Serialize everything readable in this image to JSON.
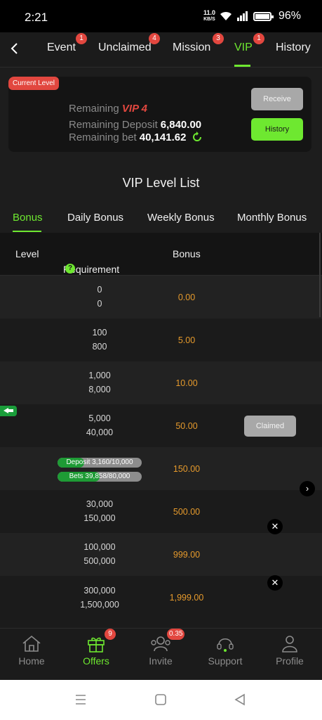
{
  "status": {
    "time": "2:21",
    "net_speed": "11.0",
    "net_unit": "KB/S",
    "battery": "96%"
  },
  "tabs": [
    {
      "label": "Event",
      "badge": "1"
    },
    {
      "label": "Unclaimed",
      "badge": "4"
    },
    {
      "label": "Mission",
      "badge": "3"
    },
    {
      "label": "VIP",
      "badge": "1",
      "active": true
    },
    {
      "label": "History"
    }
  ],
  "card": {
    "tag": "Current Level",
    "remaining_label": "Remaining",
    "vip": "VIP 4",
    "deposit_label": "Remaining Deposit",
    "deposit_value": "6,840.00",
    "bet_label": "Remaining bet",
    "bet_value": "40,141.62",
    "receive_btn": "Receive",
    "history_btn": "History"
  },
  "list_title": "VIP Level List",
  "bonus_tabs": [
    "Bonus",
    "Daily Bonus",
    "Weekly Bonus",
    "Monthly Bonus"
  ],
  "table": {
    "headers": {
      "level": "Level",
      "requirement": "Requirement",
      "help": "?",
      "bonus": "Bonus"
    },
    "rows": [
      {
        "deposit": "0",
        "bet": "0",
        "bonus": "0.00"
      },
      {
        "deposit": "100",
        "bet": "800",
        "bonus": "5.00"
      },
      {
        "deposit": "1,000",
        "bet": "8,000",
        "bonus": "10.00"
      },
      {
        "deposit": "5,000",
        "bet": "40,000",
        "bonus": "50.00",
        "status": "Claimed"
      },
      {
        "progress_deposit": "Deposit 3,160/10,000",
        "progress_bets": "Bets 39,858/80,000",
        "bonus": "150.00"
      },
      {
        "deposit": "30,000",
        "bet": "150,000",
        "bonus": "500.00"
      },
      {
        "deposit": "100,000",
        "bet": "500,000",
        "bonus": "999.00"
      },
      {
        "deposit": "300,000",
        "bet": "1,500,000",
        "bonus": "1,999.00"
      }
    ]
  },
  "progress": {
    "deposit_fraction": 0.316,
    "bets_fraction": 0.498
  },
  "bottom_nav": [
    {
      "label": "Home",
      "icon": "home-icon"
    },
    {
      "label": "Offers",
      "icon": "gift-icon",
      "badge": "9",
      "active": true
    },
    {
      "label": "Invite",
      "icon": "invite-icon",
      "badge": "0.35"
    },
    {
      "label": "Support",
      "icon": "headset-icon"
    },
    {
      "label": "Profile",
      "icon": "profile-icon"
    }
  ],
  "colors": {
    "accent": "#6ee830",
    "badge": "#e2473f",
    "bonus_value": "#e69a2c"
  }
}
